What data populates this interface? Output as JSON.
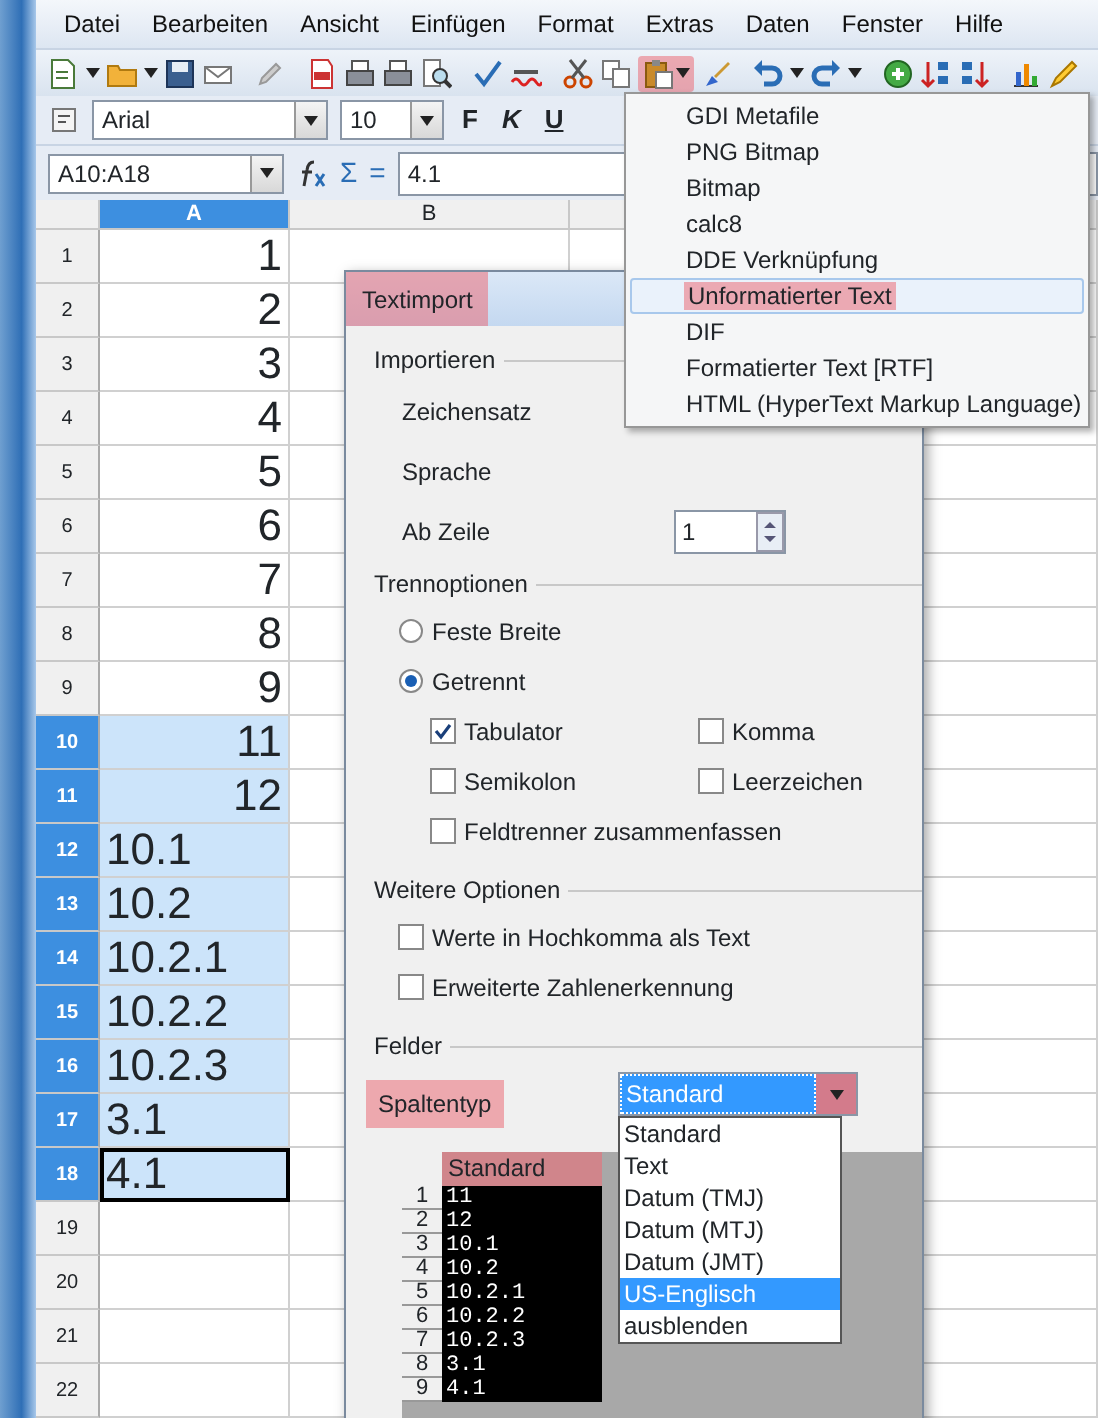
{
  "menu_bar": [
    "Datei",
    "Bearbeiten",
    "Ansicht",
    "Einfügen",
    "Format",
    "Extras",
    "Daten",
    "Fenster",
    "Hilfe"
  ],
  "toolbar": {
    "paste_button": {
      "highlighted": true
    }
  },
  "format_bar": {
    "font": "Arial",
    "size": "10",
    "styles": [
      "F",
      "K",
      "U"
    ]
  },
  "formula_bar": {
    "cell_ref": "A10:A18",
    "symbols": [
      "Σ",
      "="
    ],
    "content": "4.1"
  },
  "sheet": {
    "columns": [
      "A",
      "B"
    ],
    "rows": [
      {
        "header": "1",
        "a": "1",
        "kind": "number",
        "selected": false,
        "active": false
      },
      {
        "header": "2",
        "a": "2",
        "kind": "number",
        "selected": false,
        "active": false
      },
      {
        "header": "3",
        "a": "3",
        "kind": "number",
        "selected": false,
        "active": false
      },
      {
        "header": "4",
        "a": "4",
        "kind": "number",
        "selected": false,
        "active": false
      },
      {
        "header": "5",
        "a": "5",
        "kind": "number",
        "selected": false,
        "active": false
      },
      {
        "header": "6",
        "a": "6",
        "kind": "number",
        "selected": false,
        "active": false
      },
      {
        "header": "7",
        "a": "7",
        "kind": "number",
        "selected": false,
        "active": false
      },
      {
        "header": "8",
        "a": "8",
        "kind": "number",
        "selected": false,
        "active": false
      },
      {
        "header": "9",
        "a": "9",
        "kind": "number",
        "selected": false,
        "active": false
      },
      {
        "header": "10",
        "a": "11",
        "kind": "number",
        "selected": true,
        "active": false
      },
      {
        "header": "11",
        "a": "12",
        "kind": "number",
        "selected": true,
        "active": false
      },
      {
        "header": "12",
        "a": "10.1",
        "kind": "text",
        "selected": true,
        "active": false
      },
      {
        "header": "13",
        "a": "10.2",
        "kind": "text",
        "selected": true,
        "active": false
      },
      {
        "header": "14",
        "a": "10.2.1",
        "kind": "text",
        "selected": true,
        "active": false
      },
      {
        "header": "15",
        "a": "10.2.2",
        "kind": "text",
        "selected": true,
        "active": false
      },
      {
        "header": "16",
        "a": "10.2.3",
        "kind": "text",
        "selected": true,
        "active": false
      },
      {
        "header": "17",
        "a": "3.1",
        "kind": "text",
        "selected": true,
        "active": false
      },
      {
        "header": "18",
        "a": "4.1",
        "kind": "text",
        "selected": true,
        "active": true
      },
      {
        "header": "19",
        "selected": false,
        "active": false
      },
      {
        "header": "20",
        "selected": false,
        "active": false
      },
      {
        "header": "21",
        "selected": false,
        "active": false
      },
      {
        "header": "22",
        "selected": false,
        "active": false
      }
    ]
  },
  "paste_menu": {
    "items": [
      {
        "label": "GDI Metafile",
        "selected": false,
        "highlighted": false
      },
      {
        "label": "PNG Bitmap",
        "selected": false,
        "highlighted": false
      },
      {
        "label": "Bitmap",
        "selected": false,
        "highlighted": false
      },
      {
        "label": "calc8",
        "selected": false,
        "highlighted": false
      },
      {
        "label": "DDE Verknüpfung",
        "selected": false,
        "highlighted": false
      },
      {
        "label": "Unformatierter Text",
        "selected": true,
        "highlighted": true
      },
      {
        "label": "DIF",
        "selected": false,
        "highlighted": false
      },
      {
        "label": "Formatierter Text [RTF]",
        "selected": false,
        "highlighted": false
      },
      {
        "label": "HTML (HyperText Markup Language)",
        "selected": false,
        "highlighted": false
      }
    ]
  },
  "dialog": {
    "title": "Textimport",
    "title_highlighted": true,
    "import": {
      "heading": "Importieren",
      "charset_label": "Zeichensatz",
      "language_label": "Sprache",
      "from_row_label": "Ab Zeile",
      "from_row": "1"
    },
    "separator": {
      "heading": "Trennoptionen",
      "radios": [
        {
          "label": "Feste Breite",
          "selected": false
        },
        {
          "label": "Getrennt",
          "selected": true
        }
      ],
      "checkboxes": [
        {
          "label": "Tabulator",
          "checked": true
        },
        {
          "label": "Komma",
          "checked": false
        },
        {
          "label": "Semikolon",
          "checked": false
        },
        {
          "label": "Leerzeichen",
          "checked": false
        }
      ],
      "merge": {
        "label": "Feldtrenner zusammenfassen",
        "checked": false
      }
    },
    "other": {
      "heading": "Weitere Optionen",
      "checkboxes": [
        {
          "label": "Werte in Hochkomma als Text",
          "checked": false
        },
        {
          "label": "Erweiterte Zahlenerkennung",
          "checked": false
        }
      ]
    },
    "fields": {
      "heading": "Felder",
      "column_type_label": "Spaltentyp",
      "label_highlighted": true,
      "column_type_value": "Standard",
      "arrow_highlighted": true,
      "options": [
        {
          "label": "Standard",
          "selected": false
        },
        {
          "label": "Text",
          "selected": false
        },
        {
          "label": "Datum (TMJ)",
          "selected": false
        },
        {
          "label": "Datum (MTJ)",
          "selected": false
        },
        {
          "label": "Datum (JMT)",
          "selected": false
        },
        {
          "label": "US-Englisch",
          "selected": true
        },
        {
          "label": "ausblenden",
          "selected": false
        }
      ],
      "preview": {
        "column": "Standard",
        "column_highlighted": true,
        "rows": [
          {
            "number": "1",
            "value": "11"
          },
          {
            "number": "2",
            "value": "12"
          },
          {
            "number": "3",
            "value": "10.1"
          },
          {
            "number": "4",
            "value": "10.2"
          },
          {
            "number": "5",
            "value": "10.2.1"
          },
          {
            "number": "6",
            "value": "10.2.2"
          },
          {
            "number": "7",
            "value": "10.2.3"
          },
          {
            "number": "8",
            "value": "3.1"
          },
          {
            "number": "9",
            "value": "4.1"
          }
        ]
      }
    }
  }
}
